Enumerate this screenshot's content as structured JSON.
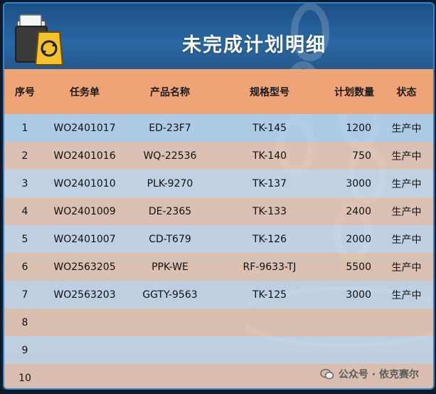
{
  "header": {
    "title": "未完成计划明细",
    "icon": "folder-hazard-icon"
  },
  "table": {
    "columns": [
      "序号",
      "任务单",
      "产品名称",
      "规格型号",
      "计划数量",
      "状态"
    ],
    "rows": [
      [
        "1",
        "WO2401017",
        "ED-23F7",
        "TK-145",
        "1200",
        "生产中"
      ],
      [
        "2",
        "WO2401016",
        "WQ-22536",
        "TK-140",
        "750",
        "生产中"
      ],
      [
        "3",
        "WO2401010",
        "PLK-9270",
        "TK-137",
        "3000",
        "生产中"
      ],
      [
        "4",
        "WO2401009",
        "DE-2365",
        "TK-133",
        "2400",
        "生产中"
      ],
      [
        "5",
        "WO2401007",
        "CD-T679",
        "TK-126",
        "2000",
        "生产中"
      ],
      [
        "6",
        "WO2563205",
        "PPK-WE",
        "RF-9633-TJ",
        "5500",
        "生产中"
      ],
      [
        "7",
        "WO2563203",
        "GGTY-9563",
        "TK-125",
        "3000",
        "生产中"
      ],
      [
        "8",
        "",
        "",
        "",
        "",
        ""
      ],
      [
        "9",
        "",
        "",
        "",
        "",
        ""
      ],
      [
        "10",
        "",
        "",
        "",
        "",
        ""
      ]
    ]
  },
  "watermark": {
    "text": "公众号 · 依克赛尔",
    "icon": "wechat-icon"
  },
  "colors": {
    "header_row": "#efa477",
    "frame_border": "#2f86c9",
    "title_bg": "#2a67a3"
  }
}
